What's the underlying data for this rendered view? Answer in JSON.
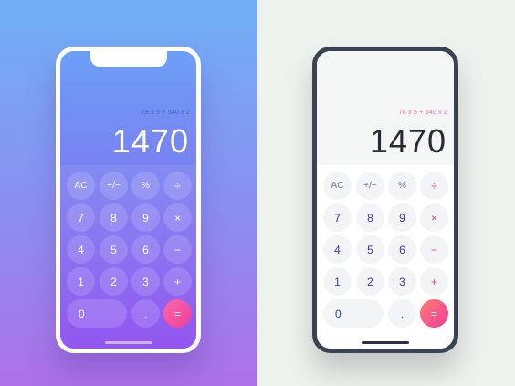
{
  "calculators": [
    {
      "theme": "gradient",
      "expression": "78 x 5 + 540 x 2",
      "result": "1470",
      "keys": {
        "ac": "AC",
        "sign": "+/−",
        "percent": "%",
        "divide": "÷",
        "seven": "7",
        "eight": "8",
        "nine": "9",
        "multiply": "×",
        "four": "4",
        "five": "5",
        "six": "6",
        "minus": "−",
        "one": "1",
        "two": "2",
        "three": "3",
        "plus": "+",
        "zero": "0",
        "dot": ".",
        "equals": "="
      }
    },
    {
      "theme": "light",
      "expression": "78 x 5 + 540 x 2",
      "result": "1470",
      "keys": {
        "ac": "AC",
        "sign": "+/−",
        "percent": "%",
        "divide": "÷",
        "seven": "7",
        "eight": "8",
        "nine": "9",
        "multiply": "×",
        "four": "4",
        "five": "5",
        "six": "6",
        "minus": "−",
        "one": "1",
        "two": "2",
        "three": "3",
        "plus": "+",
        "zero": "0",
        "dot": ".",
        "equals": "="
      }
    }
  ],
  "colors": {
    "accent_pink": "#ee3d9a",
    "light_operator": "#e2449a",
    "light_digit": "#3b3a9c",
    "dark_frame": "#3a4352"
  }
}
